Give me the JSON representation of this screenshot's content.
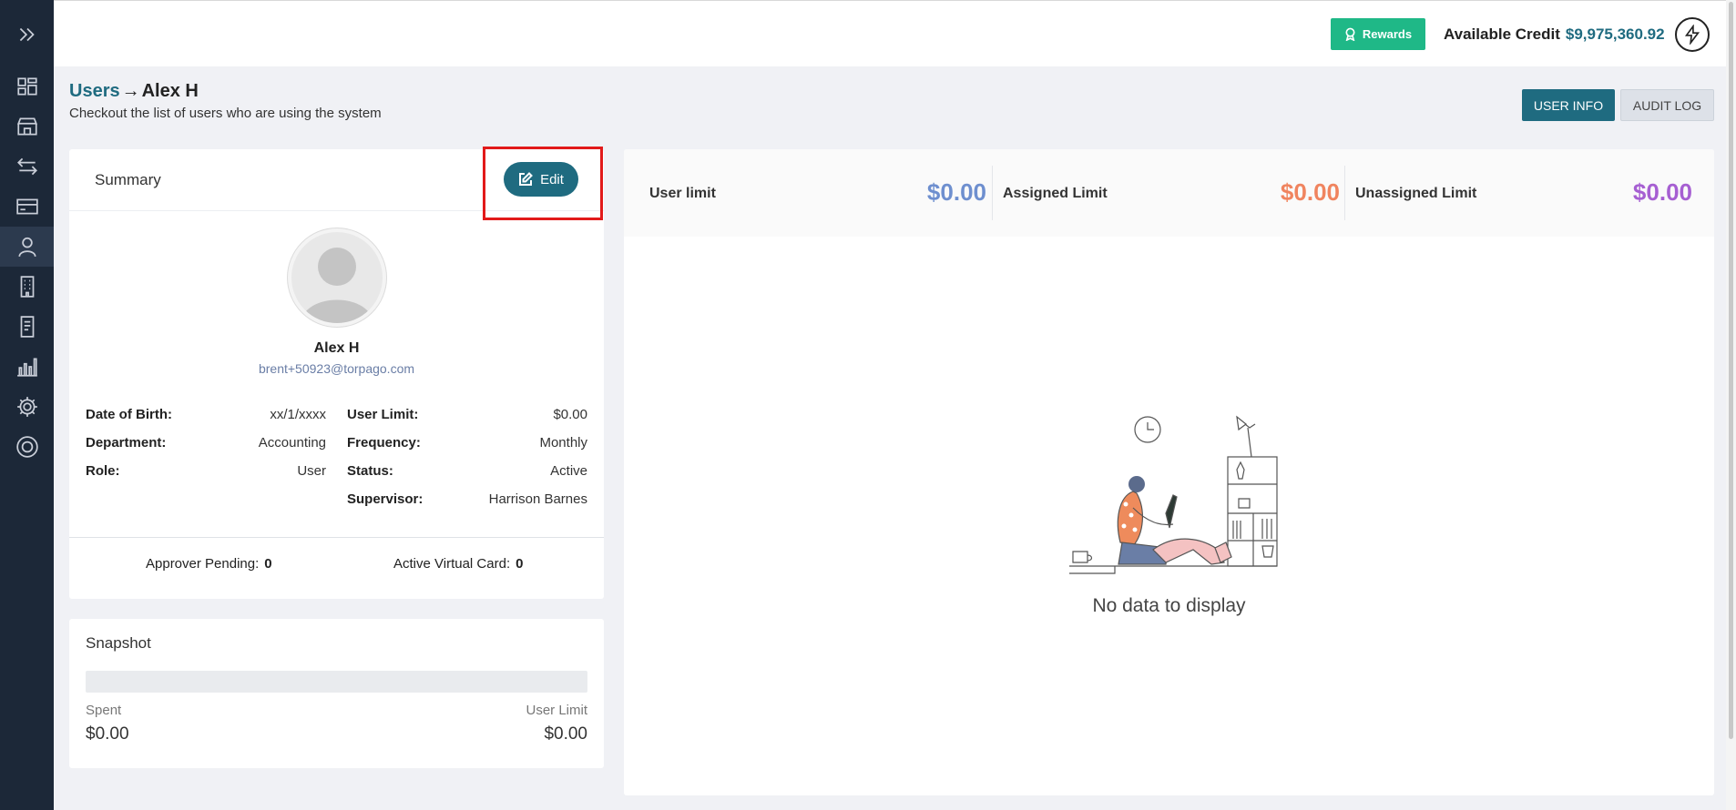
{
  "sidebar": {
    "items": [
      {
        "icon": "expand-chevrons-icon"
      },
      {
        "icon": "dashboard-icon"
      },
      {
        "icon": "store-icon"
      },
      {
        "icon": "transfer-arrows-icon"
      },
      {
        "icon": "credit-card-icon"
      },
      {
        "icon": "user-icon",
        "active": true
      },
      {
        "icon": "building-icon"
      },
      {
        "icon": "document-icon"
      },
      {
        "icon": "bar-chart-icon"
      },
      {
        "icon": "gear-icon"
      },
      {
        "icon": "help-icon"
      }
    ]
  },
  "header": {
    "rewards_label": "Rewards",
    "credit_label": "Available Credit",
    "credit_amount": "$9,975,360.92"
  },
  "breadcrumb": {
    "parent": "Users",
    "separator": "→",
    "current": "Alex H"
  },
  "page": {
    "subtitle": "Checkout the list of users who are using the system",
    "tabs": [
      {
        "label": "USER INFO",
        "active": true
      },
      {
        "label": "AUDIT LOG",
        "active": false
      }
    ]
  },
  "summary": {
    "title": "Summary",
    "edit_label": "Edit",
    "name": "Alex H",
    "email": "brent+50923@torpago.com",
    "left_fields": [
      {
        "label": "Date of Birth:",
        "value": "xx/1/xxxx"
      },
      {
        "label": "Department:",
        "value": "Accounting"
      },
      {
        "label": "Role:",
        "value": "User"
      }
    ],
    "right_fields": [
      {
        "label": "User Limit:",
        "value": "$0.00"
      },
      {
        "label": "Frequency:",
        "value": "Monthly"
      },
      {
        "label": "Status:",
        "value": "Active"
      },
      {
        "label": "Supervisor:",
        "value": "Harrison Barnes"
      }
    ],
    "approver_pending_label": "Approver Pending:",
    "approver_pending_value": "0",
    "active_virtual_card_label": "Active Virtual Card:",
    "active_virtual_card_value": "0"
  },
  "snapshot": {
    "title": "Snapshot",
    "progress": 0,
    "spent_label": "Spent",
    "spent_value": "$0.00",
    "limit_label": "User Limit",
    "limit_value": "$0.00"
  },
  "limits": [
    {
      "label": "User limit",
      "value": "$0.00",
      "color": "#6e8fcf"
    },
    {
      "label": "Assigned Limit",
      "value": "$0.00",
      "color": "#f0845f"
    },
    {
      "label": "Unassigned Limit",
      "value": "$0.00",
      "color": "#a65fd2"
    }
  ],
  "empty_state": {
    "text": "No data to display"
  },
  "colors": {
    "accent": "#1f6b80",
    "rewards": "#1fb887",
    "sidebar_bg": "#1c2838",
    "highlight": "#e21a1a"
  }
}
